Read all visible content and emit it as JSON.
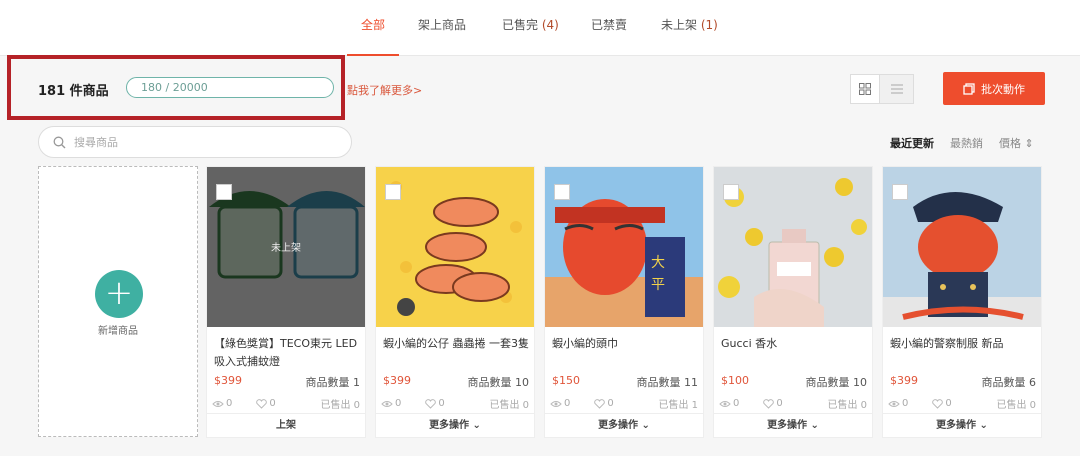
{
  "tabs": [
    {
      "label": "全部",
      "count": ""
    },
    {
      "label": "架上商品",
      "count": ""
    },
    {
      "label": "已售完",
      "count": "(4)"
    },
    {
      "label": "已禁賣",
      "count": ""
    },
    {
      "label": "未上架",
      "count": "(1)"
    }
  ],
  "header": {
    "product_count": "181 件商品",
    "quota": "180 / 20000",
    "learn_more": "點我了解更多>",
    "batch_label": "批次動作"
  },
  "search": {
    "placeholder": "搜尋商品"
  },
  "sort": {
    "recent": "最近更新",
    "best": "最熱銷",
    "price": "價格 ⇕"
  },
  "add": {
    "label": "新增商品"
  },
  "products": [
    {
      "name": "【綠色獎賞】TECO東元 LED吸入式捕蚊燈",
      "price": "$399",
      "qty": "商品數量 1",
      "views": "0",
      "likes": "0",
      "sold": "已售出 0",
      "action": "上架",
      "badge": "未上架"
    },
    {
      "name": "蝦小編的公仔 蟲蟲捲 一套3隻",
      "price": "$399",
      "qty": "商品數量 10",
      "views": "0",
      "likes": "0",
      "sold": "已售出 0",
      "action": "更多操作",
      "badge": ""
    },
    {
      "name": "蝦小編的頭巾",
      "price": "$150",
      "qty": "商品數量 11",
      "views": "0",
      "likes": "0",
      "sold": "已售出 1",
      "action": "更多操作",
      "badge": ""
    },
    {
      "name": "Gucci 香水",
      "price": "$100",
      "qty": "商品數量 10",
      "views": "0",
      "likes": "0",
      "sold": "已售出 0",
      "action": "更多操作",
      "badge": ""
    },
    {
      "name": "蝦小編的警察制服 新品",
      "price": "$399",
      "qty": "商品數量 6",
      "views": "0",
      "likes": "0",
      "sold": "已售出 0",
      "action": "更多操作",
      "badge": ""
    }
  ],
  "colors": {
    "accent": "#ee4d2d",
    "teal": "#3fb0a2",
    "highlight_box": "#b52227"
  }
}
